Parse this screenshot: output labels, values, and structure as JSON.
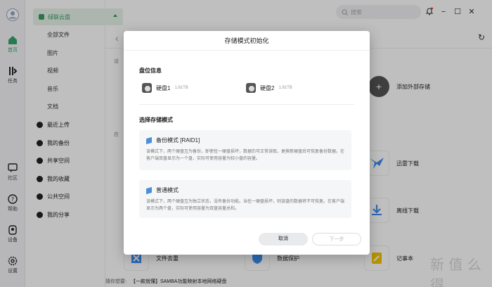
{
  "rail": {
    "home": "首页",
    "tasks": "任务",
    "community": "社区",
    "help": "帮助",
    "device": "设备",
    "settings": "设置"
  },
  "sidebar": {
    "cloud_title": "绿联云盘",
    "sub_items": [
      "全部文件",
      "图片",
      "视频",
      "音乐",
      "文档"
    ],
    "items": [
      "最近上传",
      "我的备份",
      "共享空间",
      "我的收藏",
      "公共空间",
      "我的分享"
    ]
  },
  "topbar": {
    "search_placeholder": "搜索"
  },
  "main": {
    "section_devices": "设",
    "section_apps": "应",
    "add_external": "添加外部存储",
    "thunder": "迅雷下载",
    "offline": "离线下载",
    "dedupe": "文件去重",
    "protect": "数据保护",
    "notes": "记事本"
  },
  "footer": {
    "key": "猜你想要:",
    "text": "【一款就懂】SAMBA功能映射本地网络硬盘"
  },
  "watermark": "新 值 么 得",
  "modal": {
    "title": "存储模式初始化",
    "disk_section": "盘位信息",
    "disks": [
      {
        "name": "硬盘1",
        "size": "1.81TB"
      },
      {
        "name": "硬盘2",
        "size": "1.81TB"
      }
    ],
    "mode_section": "选择存储模式",
    "modes": [
      {
        "title": "备份模式 [RAID1]",
        "desc": "该模式下，两个硬盘互为备份，即使任一硬盘损坏，数据仍可正常读取，更换新硬盘后可恢复备份数据。在客户端双盘显示为一个盘，实际可使用容量为较小盘的容量。"
      },
      {
        "title": "普通模式",
        "desc": "该模式下，两个硬盘互为独立状态，没有备份功能。当任一硬盘损坏，则该盘的数据将不可恢复。在客户端显示为两个盘，实际可使用容量为双盘容量总和。"
      }
    ],
    "cancel": "取消",
    "next": "下一步"
  },
  "colors": {
    "accent": "#35a56a",
    "cloud_bg": "#e6f3ea",
    "mode_icon": "#4a90d9"
  }
}
